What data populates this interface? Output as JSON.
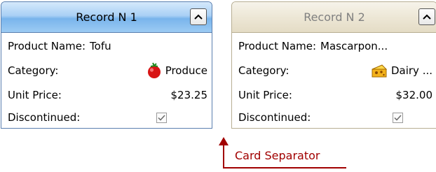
{
  "cards": [
    {
      "title": "Record N 1",
      "product_label": "Product Name:",
      "product_value": "Tofu",
      "category_label": "Category:",
      "category_value": "Produce",
      "category_icon": "tomato-icon",
      "price_label": "Unit Price:",
      "price_value": "$23.25",
      "discontinued_label": "Discontinued:",
      "discontinued_checked": true
    },
    {
      "title": "Record N 2",
      "product_label": "Product Name:",
      "product_value": "Mascarpon...",
      "category_label": "Category:",
      "category_value": "Dairy ...",
      "category_icon": "cheese-icon",
      "price_label": "Unit Price:",
      "price_value": "$32.00",
      "discontinued_label": "Discontinued:",
      "discontinued_checked": true
    }
  ],
  "annotation": {
    "label": "Card Separator",
    "color": "#a10000"
  },
  "colors": {
    "active_header": "#79b4ec",
    "inactive_header": "#e4dcc5",
    "active_border": "#5a7faf"
  }
}
